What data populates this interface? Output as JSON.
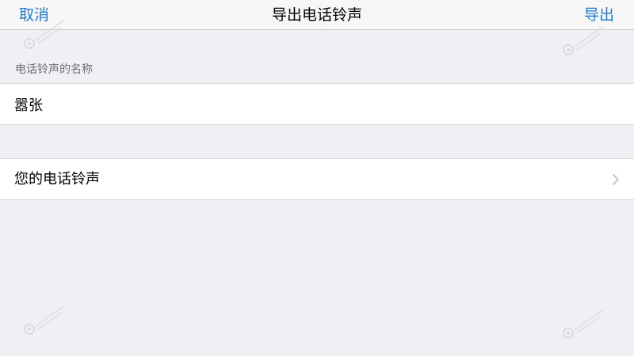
{
  "navbar": {
    "cancel_label": "取消",
    "title": "导出电话铃声",
    "export_label": "导出"
  },
  "form": {
    "name_section_header": "电话铃声的名称",
    "name_value": "嚣张",
    "ringtones_label": "您的电话铃声"
  },
  "icons": {
    "chevron": "chevron-right-icon",
    "watermark": "watermark-logo-icon"
  },
  "colors": {
    "accent": "#1a7bd6",
    "background": "#efeff4",
    "navbar_bg": "#f7f7f7",
    "section_header_text": "#6d6d72",
    "chevron": "#c7c7cc"
  }
}
